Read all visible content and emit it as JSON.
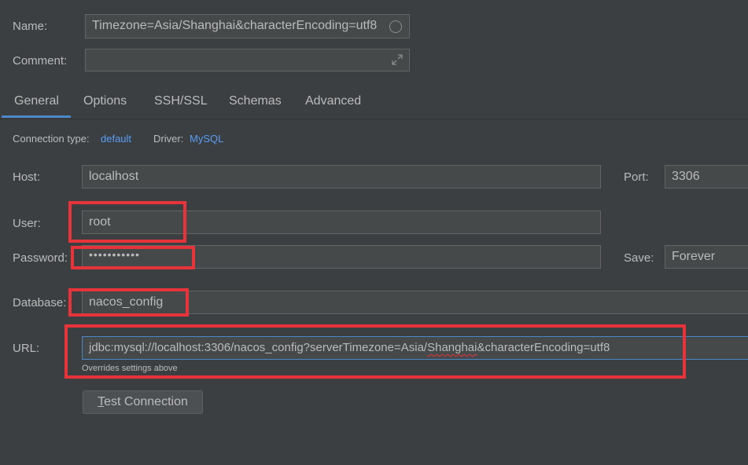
{
  "header": {
    "name_label": "Name:",
    "name_value": "Timezone=Asia/Shanghai&characterEncoding=utf8",
    "comment_label": "Comment:",
    "comment_value": ""
  },
  "tabs": [
    {
      "label": "General",
      "active": true
    },
    {
      "label": "Options",
      "active": false
    },
    {
      "label": "SSH/SSL",
      "active": false
    },
    {
      "label": "Schemas",
      "active": false
    },
    {
      "label": "Advanced",
      "active": false
    }
  ],
  "connection": {
    "type_label": "Connection type:",
    "type_value": "default",
    "driver_label": "Driver:",
    "driver_value": "MySQL"
  },
  "form": {
    "host_label": "Host:",
    "host_value": "localhost",
    "port_label": "Port:",
    "port_value": "3306",
    "user_label": "User:",
    "user_value": "root",
    "password_label": "Password:",
    "password_value": "•••••••••••",
    "save_label": "Save:",
    "save_value": "Forever",
    "database_label": "Database:",
    "database_value": "nacos_config",
    "url_label": "URL:",
    "url_prefix": "jdbc:mysql://localhost:3306/nacos_config?serverTimezone=Asia/",
    "url_misspelled": "Shanghai",
    "url_suffix": "&characterEncoding=utf8",
    "url_hint": "Overrides settings above"
  },
  "actions": {
    "test_connection_mnemonic": "T",
    "test_connection_rest": "est Connection"
  },
  "colors": {
    "background": "#3c3f41",
    "field_bg": "#45494a",
    "link": "#589df6",
    "accent": "#4a88c7",
    "highlight": "#e9333a"
  }
}
